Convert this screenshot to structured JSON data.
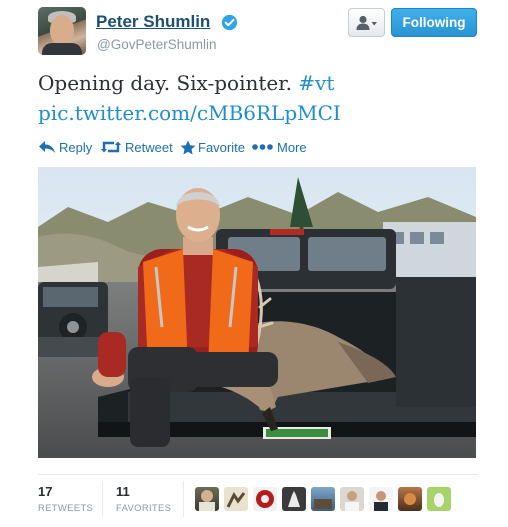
{
  "user": {
    "name": "Peter Shumlin",
    "handle": "@GovPeterShumlin",
    "verified": true
  },
  "buttons": {
    "follow_label": "Following"
  },
  "tweet": {
    "text": "Opening day. Six-pointer.",
    "hashtag": "#vt",
    "link": "pic.twitter.com/cMB6RLpMCI"
  },
  "actions": {
    "reply": "Reply",
    "retweet": "Retweet",
    "favorite": "Favorite",
    "more": "More"
  },
  "stats": {
    "retweets_count": "17",
    "retweets_label": "RETWEETS",
    "favorites_count": "11",
    "favorites_label": "FAVORITES"
  },
  "colors": {
    "link": "#1d8ecf",
    "name": "#1c4f78",
    "following_button": "#2a93d2"
  }
}
